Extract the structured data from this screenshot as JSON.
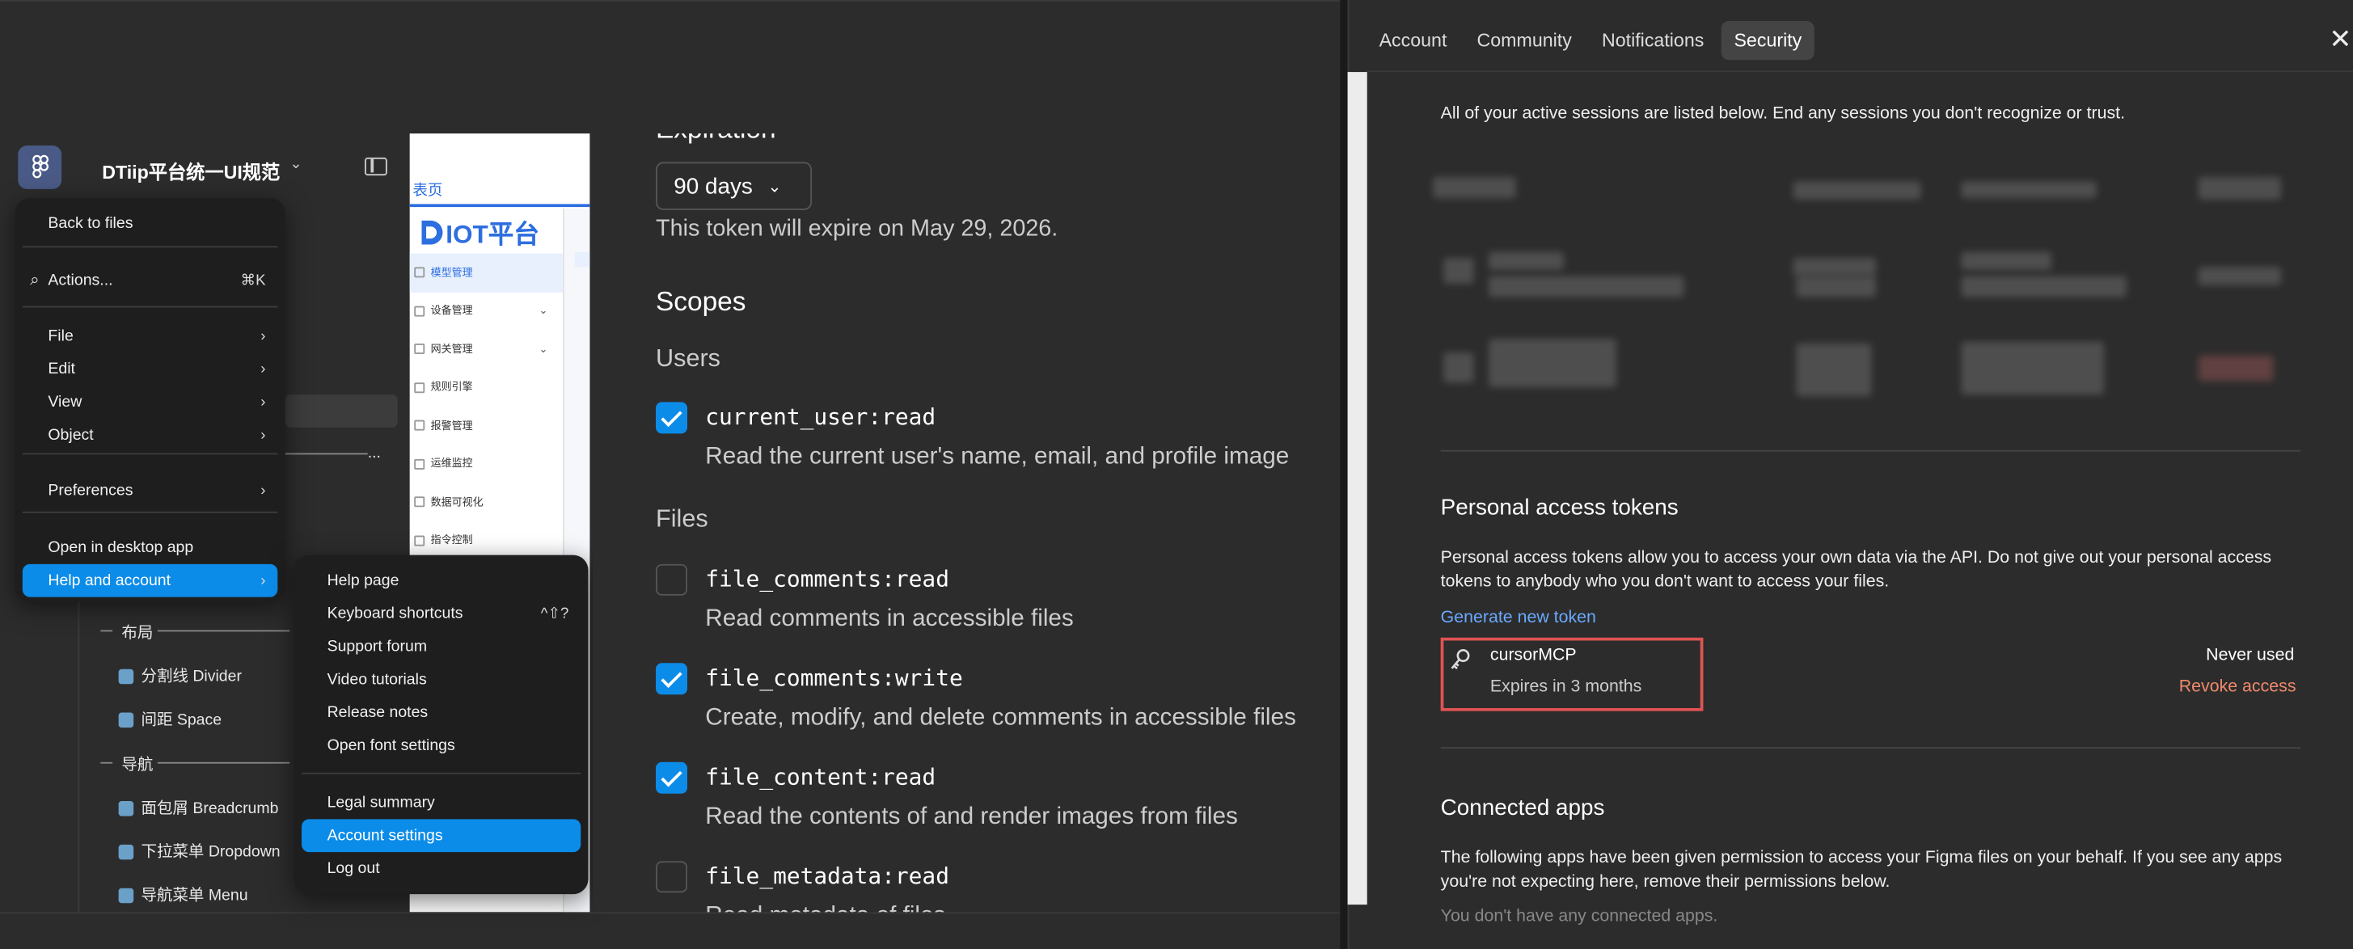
{
  "figma": {
    "file_title": "DTiip平台统一UI规范",
    "menu_main": [
      {
        "label": "Back to files",
        "shortcut": "",
        "arrow": false
      },
      {
        "label": "Actions...",
        "shortcut": "⌘K",
        "arrow": false
      },
      {
        "label": "File",
        "shortcut": "",
        "arrow": true
      },
      {
        "label": "Edit",
        "shortcut": "",
        "arrow": true
      },
      {
        "label": "View",
        "shortcut": "",
        "arrow": true
      },
      {
        "label": "Object",
        "shortcut": "",
        "arrow": true
      },
      {
        "label": "Preferences",
        "shortcut": "",
        "arrow": true
      },
      {
        "label": "Open in desktop app",
        "shortcut": "",
        "arrow": false
      },
      {
        "label": "Help and account",
        "shortcut": "",
        "arrow": true
      }
    ],
    "menu_help": [
      {
        "label": "Help page",
        "shortcut": ""
      },
      {
        "label": "Keyboard shortcuts",
        "shortcut": "^⇧?"
      },
      {
        "label": "Support forum",
        "shortcut": ""
      },
      {
        "label": "Video tutorials",
        "shortcut": ""
      },
      {
        "label": "Release notes",
        "shortcut": ""
      },
      {
        "label": "Open font settings",
        "shortcut": ""
      },
      {
        "label": "Legal summary",
        "shortcut": ""
      },
      {
        "label": "Account settings",
        "shortcut": ""
      },
      {
        "label": "Log out",
        "shortcut": ""
      }
    ],
    "layers": {
      "section_layout": "布局",
      "divider": "分割线 Divider",
      "space": "间距 Space",
      "section_nav": "导航",
      "breadcrumb": "面包屑 Breadcrumb",
      "dropdown": "下拉菜单 Dropdown",
      "menu": "导航菜单 Menu",
      "truncated": "..."
    },
    "canvas": {
      "tab_label": "表页",
      "logo_text": "IOT平台",
      "menu": [
        {
          "label": "模型管理",
          "active": true,
          "chevron": ""
        },
        {
          "label": "设备管理",
          "active": false,
          "chevron": "⌄"
        },
        {
          "label": "网关管理",
          "active": false,
          "chevron": "⌄"
        },
        {
          "label": "规则引擎",
          "active": false,
          "chevron": ""
        },
        {
          "label": "报警管理",
          "active": false,
          "chevron": ""
        },
        {
          "label": "运维监控",
          "active": false,
          "chevron": ""
        },
        {
          "label": "数据可视化",
          "active": false,
          "chevron": ""
        },
        {
          "label": "指令控制",
          "active": false,
          "chevron": ""
        }
      ]
    }
  },
  "token_dialog": {
    "expiration_label": "Expiration",
    "expiration_value": "90 days",
    "expiration_note": "This token will expire on May 29, 2026.",
    "scopes_title": "Scopes",
    "group_users": "Users",
    "group_files": "Files",
    "scopes": [
      {
        "name": "current_user:read",
        "desc": "Read the current user's name, email, and profile image",
        "checked": true
      },
      {
        "name": "file_comments:read",
        "desc": "Read comments in accessible files",
        "checked": false
      },
      {
        "name": "file_comments:write",
        "desc": "Create, modify, and delete comments in accessible files",
        "checked": true
      },
      {
        "name": "file_content:read",
        "desc": "Read the contents of and render images from files",
        "checked": true
      },
      {
        "name": "file_metadata:read",
        "desc": "Read metadata of files",
        "checked": false
      }
    ]
  },
  "settings": {
    "tabs": [
      "Account",
      "Community",
      "Notifications",
      "Security"
    ],
    "active_tab": "Security",
    "sessions_note": "All of your active sessions are listed below. End any sessions you don't recognize or trust.",
    "pat_title": "Personal access tokens",
    "pat_desc": "Personal access tokens allow you to access your own data via the API. Do not give out your personal access tokens to anybody who you don't want to access your files.",
    "generate_label": "Generate new token",
    "token": {
      "name": "cursorMCP",
      "expires": "Expires in 3 months",
      "usage": "Never used",
      "revoke": "Revoke access"
    },
    "connected_title": "Connected apps",
    "connected_desc": "The following apps have been given permission to access your Figma files on your behalf. If you see any apps you're not expecting here, remove their permissions below.",
    "connected_none": "You don't have any connected apps."
  },
  "colors": {
    "accent": "#0c8ce9",
    "link": "#6aa9ff",
    "danger": "#f08a6c",
    "highlight_box": "#e05353"
  }
}
